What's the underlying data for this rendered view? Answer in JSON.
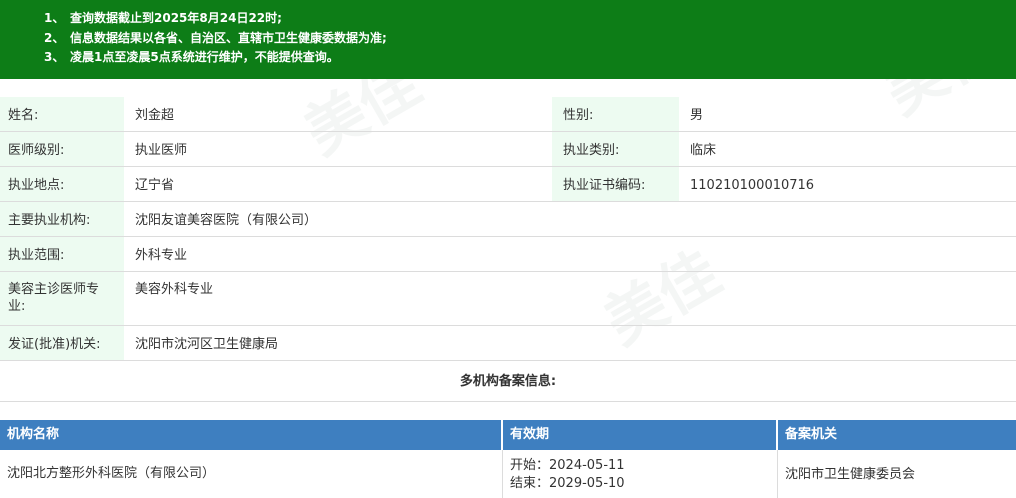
{
  "notice": {
    "lines": [
      {
        "num": "1、",
        "text": "查询数据截止到2025年8月24日22时;"
      },
      {
        "num": "2、",
        "text": "信息数据结果以各省、自治区、直辖市卫生健康委数据为准;"
      },
      {
        "num": "3、",
        "text": "凌晨1点至凌晨5点系统进行维护，不能提供查询。"
      }
    ]
  },
  "info": {
    "name_label": "姓名:",
    "name_value": "刘金超",
    "gender_label": "性别:",
    "gender_value": "男",
    "level_label": "医师级别:",
    "level_value": "执业医师",
    "category_label": "执业类别:",
    "category_value": "临床",
    "location_label": "执业地点:",
    "location_value": "辽宁省",
    "cert_label": "执业证书编码:",
    "cert_value": "110210100010716",
    "org_label": "主要执业机构:",
    "org_value": "沈阳友谊美容医院（有限公司）",
    "scope_label": "执业范围:",
    "scope_value": "外科专业",
    "cosmetic_label_line1": "美容主诊医师专",
    "cosmetic_label_line2": "业:",
    "cosmetic_value": "美容外科专业",
    "issuer_label": "发证(批准)机关:",
    "issuer_value": "沈阳市沈河区卫生健康局"
  },
  "multi_title": "多机构备案信息:",
  "table": {
    "headers": [
      "机构名称",
      "有效期",
      "备案机关"
    ],
    "rows": [
      {
        "org": "沈阳北方整形外科医院（有限公司）",
        "start": "开始：2024-05-11",
        "end": "结束：2029-05-10",
        "authority": "沈阳市卫生健康委员会"
      }
    ]
  },
  "watermark": "美佳"
}
